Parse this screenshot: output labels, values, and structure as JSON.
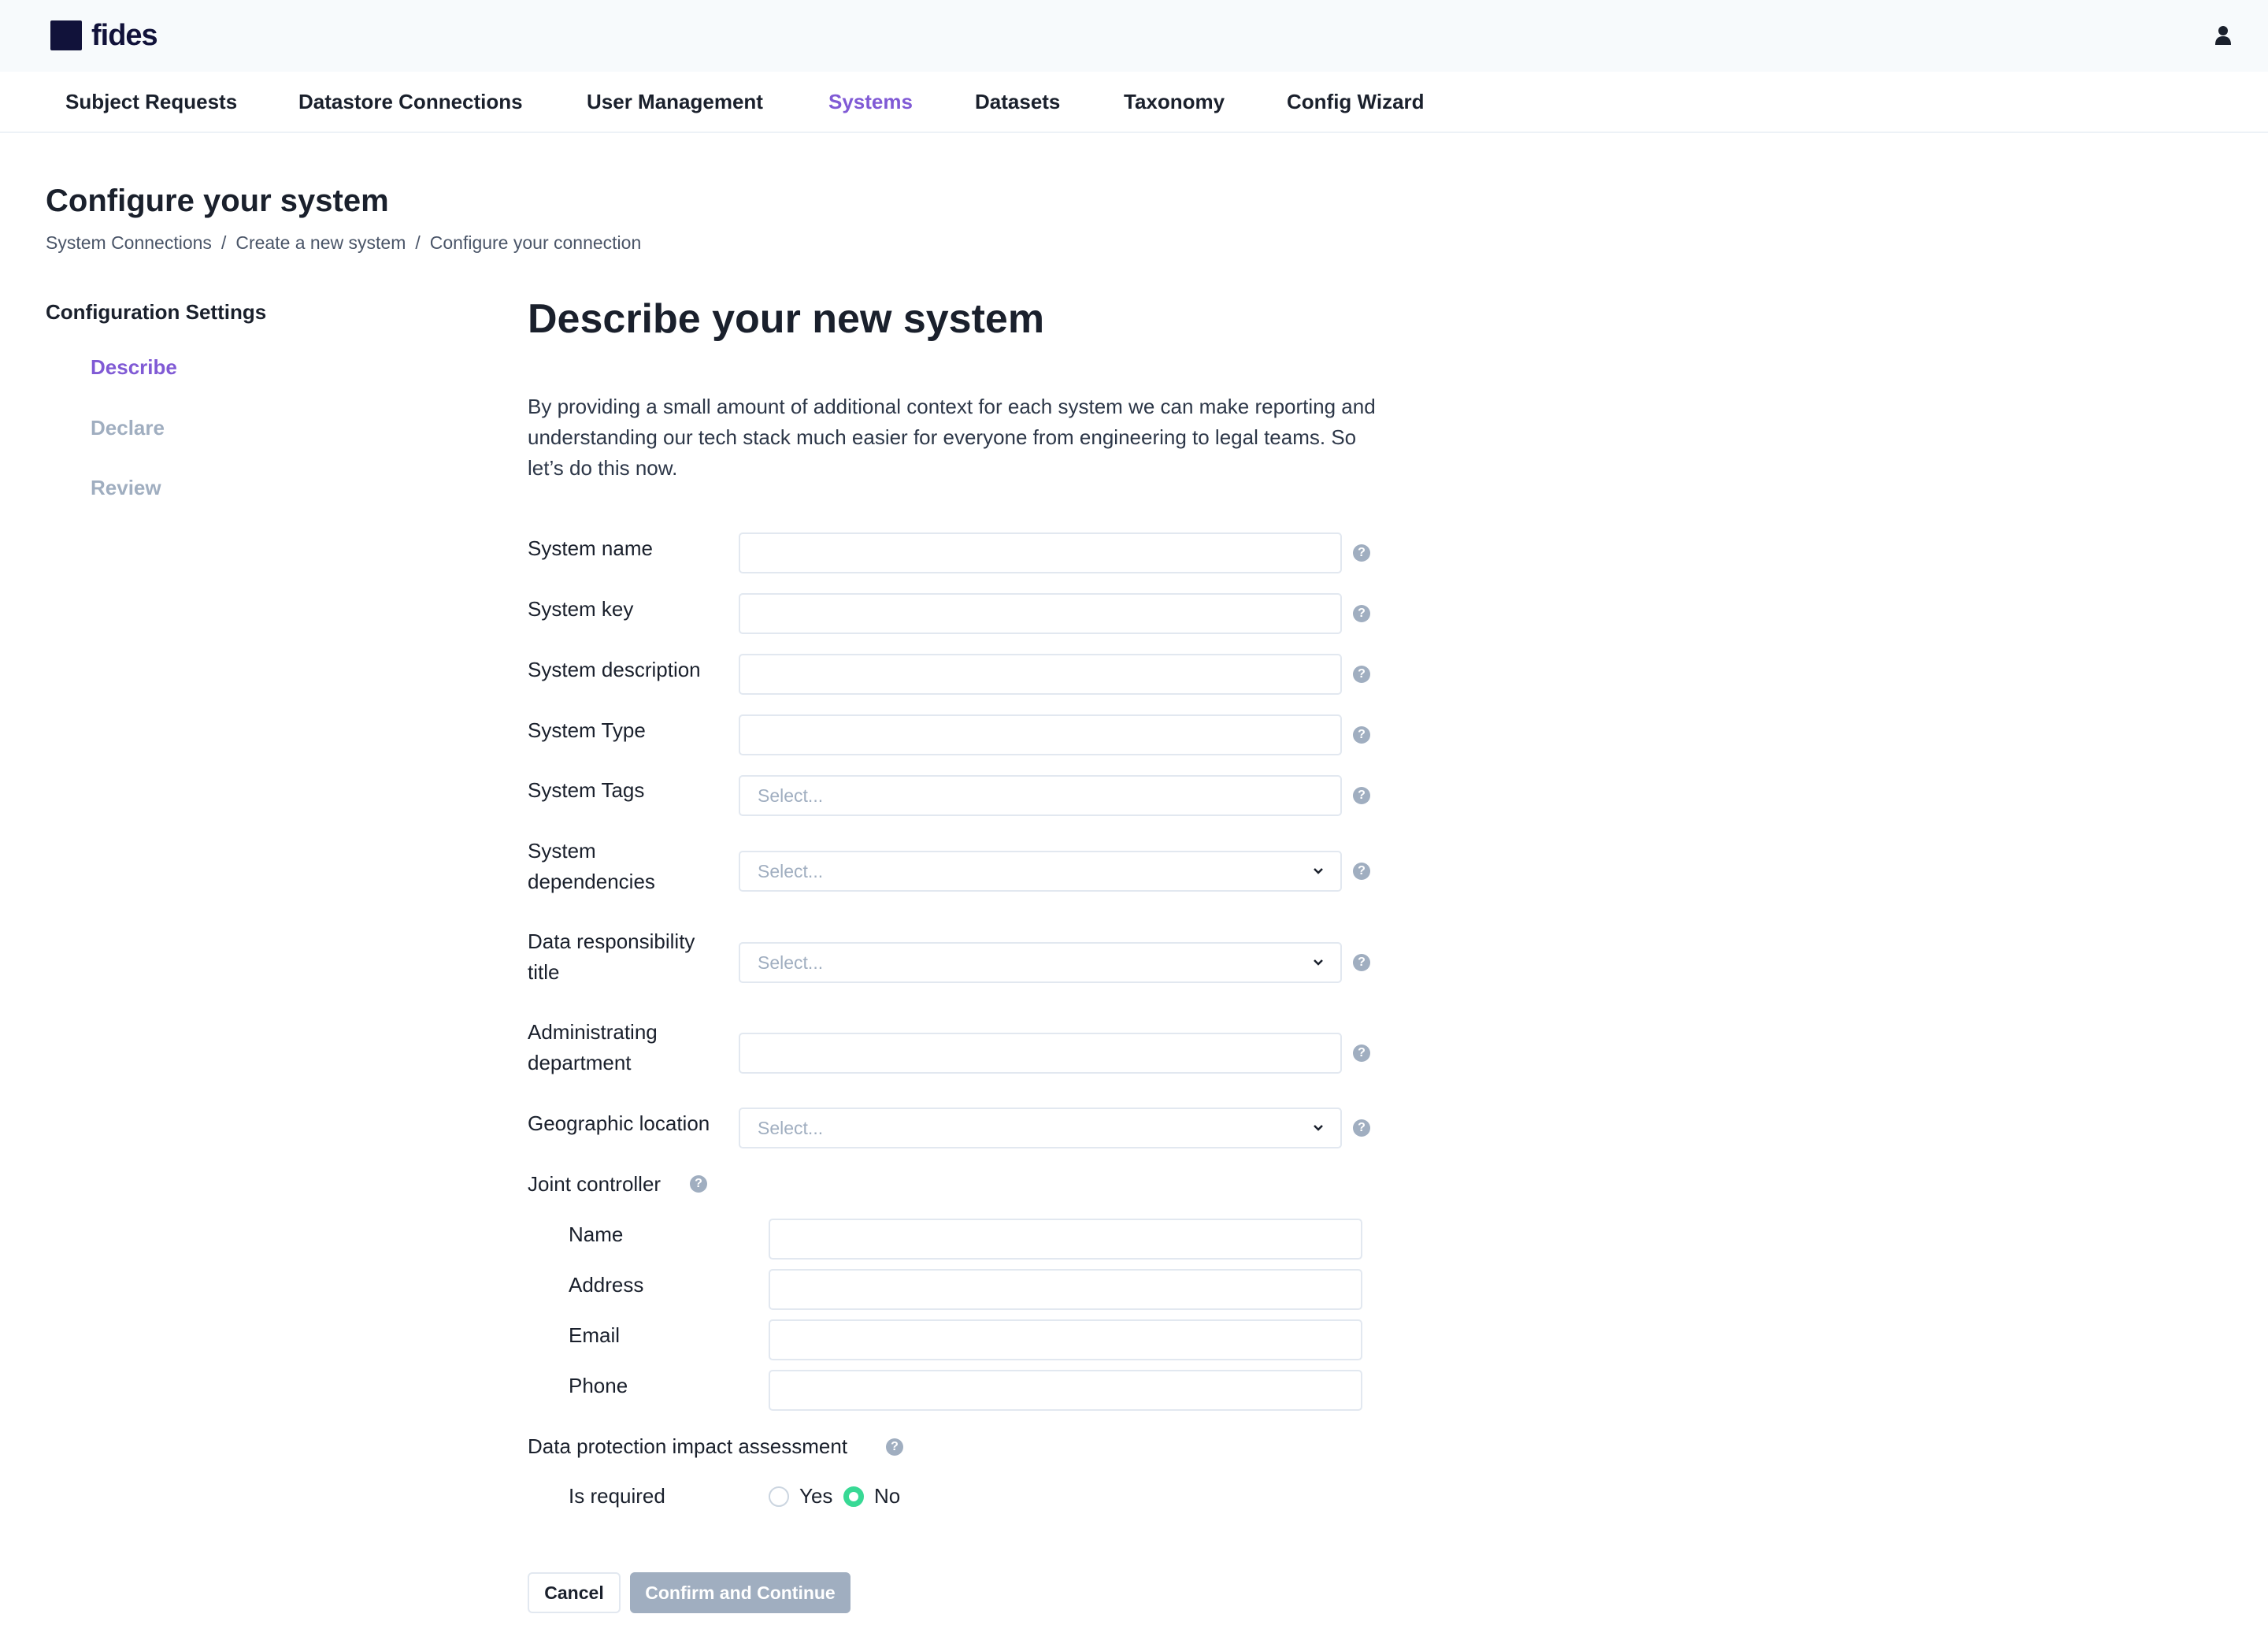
{
  "brand": {
    "name": "fides",
    "logo_color": "#11123a",
    "accent": "#805ad5"
  },
  "header": {
    "user_icon": "user-icon"
  },
  "nav": {
    "items": [
      {
        "label": "Subject Requests"
      },
      {
        "label": "Datastore Connections"
      },
      {
        "label": "User Management"
      },
      {
        "label": "Systems",
        "active": true
      },
      {
        "label": "Datasets"
      },
      {
        "label": "Taxonomy"
      },
      {
        "label": "Config Wizard"
      }
    ]
  },
  "page": {
    "title": "Configure your system",
    "breadcrumb": [
      "System Connections",
      "Create a new system",
      "Configure your connection"
    ],
    "breadcrumb_separator": "/"
  },
  "sidebar": {
    "title": "Configuration Settings",
    "steps": [
      {
        "label": "Describe",
        "active": true
      },
      {
        "label": "Declare"
      },
      {
        "label": "Review"
      }
    ]
  },
  "form": {
    "heading": "Describe your new system",
    "intro": "By providing a small amount of additional context for each system we can make reporting and understanding our tech stack much easier for everyone from engineering to legal teams. So let’s do this now.",
    "help_glyph": "?",
    "fields": {
      "system_name": {
        "label": "System name",
        "value": ""
      },
      "system_key": {
        "label": "System key",
        "value": ""
      },
      "system_description": {
        "label": "System description",
        "value": ""
      },
      "system_type": {
        "label": "System Type",
        "value": ""
      },
      "system_tags": {
        "label": "System Tags",
        "placeholder": "Select..."
      },
      "system_dependencies": {
        "label": "System dependencies",
        "placeholder": "Select..."
      },
      "data_responsibility_title": {
        "label": "Data responsibility title",
        "placeholder": "Select..."
      },
      "administrating_department": {
        "label": "Administrating department",
        "value": ""
      },
      "geographic_location": {
        "label": "Geographic location",
        "placeholder": "Select..."
      }
    },
    "joint_controller": {
      "label": "Joint controller",
      "name": {
        "label": "Name",
        "value": ""
      },
      "address": {
        "label": "Address",
        "value": ""
      },
      "email": {
        "label": "Email",
        "value": ""
      },
      "phone": {
        "label": "Phone",
        "value": ""
      }
    },
    "dpia": {
      "label": "Data protection impact assessment",
      "is_required_label": "Is required",
      "options": {
        "yes": "Yes",
        "no": "No"
      },
      "selected": "No",
      "radio_color": "#38d995"
    }
  },
  "buttons": {
    "cancel": "Cancel",
    "confirm": "Confirm and Continue"
  }
}
